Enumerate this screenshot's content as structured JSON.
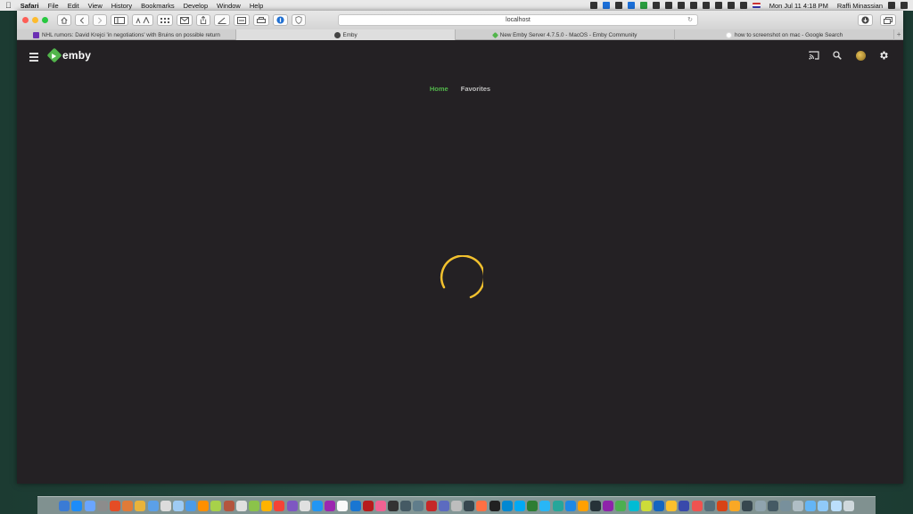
{
  "menubar": {
    "app_name": "Safari",
    "menus": [
      "File",
      "Edit",
      "View",
      "History",
      "Bookmarks",
      "Develop",
      "Window",
      "Help"
    ],
    "clock": "Mon Jul 11  4:18 PM",
    "user": "Raffi Minassian"
  },
  "browser": {
    "address": "localhost",
    "tabs": [
      {
        "title": "NHL rumors: David Krejci 'in negotiations' with Bruins on possible return"
      },
      {
        "title": "Emby"
      },
      {
        "title": "New Emby Server 4.7.5.0 - MacOS - Emby Community"
      },
      {
        "title": "how to screenshot on mac - Google Search"
      }
    ]
  },
  "emby": {
    "logo": "emby",
    "nav": [
      {
        "label": "Home",
        "active": true
      },
      {
        "label": "Favorites",
        "active": false
      }
    ],
    "accent_color": "#52b54b",
    "spinner_color": "#f2c12e"
  },
  "dock": {
    "icon_colors": [
      "#3a7bd5",
      "#1d8cf8",
      "#6aa5ff",
      "#8c8c8c",
      "#e44d26",
      "#e07b39",
      "#e9b33b",
      "#5ba0e8",
      "#dcdcdc",
      "#9ecbf4",
      "#4c9be8",
      "#ff8f00",
      "#a7d14a",
      "#b4553e",
      "#e0e0e0",
      "#8bc34a",
      "#ffb300",
      "#f44336",
      "#7e57c2",
      "#e0e0e0",
      "#2196f3",
      "#9c27b0",
      "#fafafa",
      "#1976d2",
      "#b71c1c",
      "#f06292",
      "#333333",
      "#455a64",
      "#607d8b",
      "#c62828",
      "#5c6bc0",
      "#bdbdbd",
      "#37474f",
      "#ff7043",
      "#212121",
      "#0288d1",
      "#03a9f4",
      "#2e7d32",
      "#29b6f6",
      "#26a69a",
      "#1e88e5",
      "#ffa000",
      "#263238",
      "#8e24aa",
      "#4caf50",
      "#00bcd4",
      "#cddc39",
      "#1565c0",
      "#fbc02d",
      "#3949ab",
      "#ef5350",
      "#546e7a",
      "#d84315",
      "#f9a825",
      "#37474f",
      "#90a4ae",
      "#455a64",
      "#78909c",
      "#b0bec5",
      "#64b5f6",
      "#90caf9",
      "#bbdefb",
      "#cfd8dc"
    ]
  }
}
